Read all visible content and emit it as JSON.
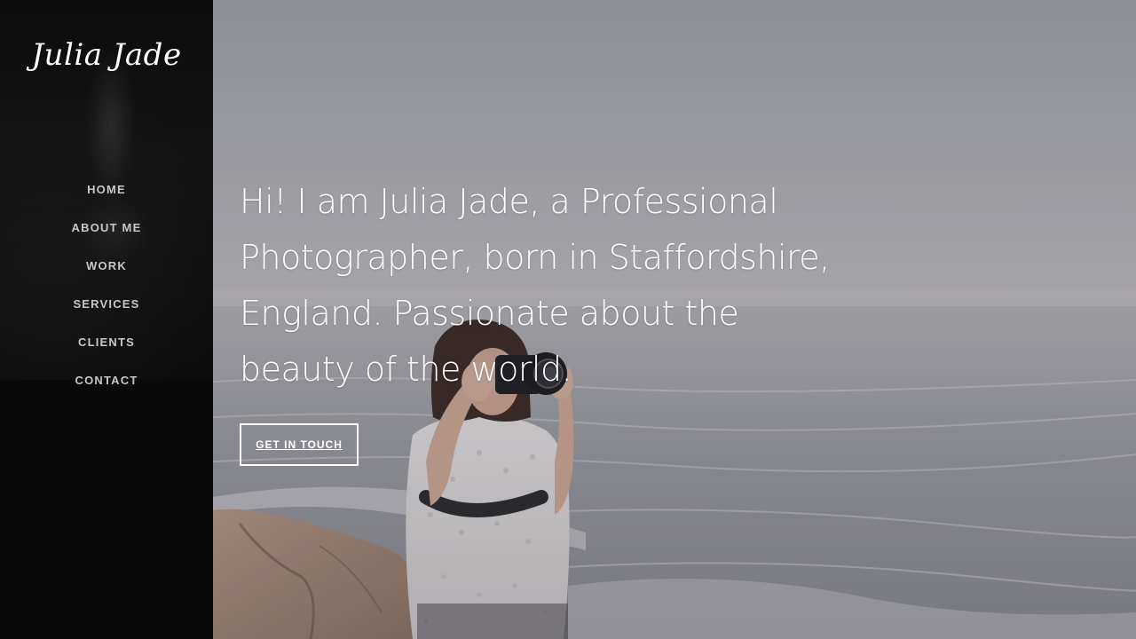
{
  "site": {
    "logo_text": "Julia Jade"
  },
  "nav": {
    "items": [
      {
        "label": "HOME"
      },
      {
        "label": "ABOUT ME"
      },
      {
        "label": "WORK"
      },
      {
        "label": "SERVICES"
      },
      {
        "label": "CLIENTS"
      },
      {
        "label": "CONTACT"
      }
    ]
  },
  "hero": {
    "headline": "Hi! I am Julia Jade, a Professional Photographer, born in Staffordshire, England. Passionate about the beauty of the world.",
    "cta_label": "GET IN TOUCH",
    "image_subject": "photographer-on-beach"
  },
  "colors": {
    "sidebar_bg": "#0a0a0a",
    "nav_text": "#c8c8c8",
    "hero_text": "#ffffff",
    "cta_border": "#ffffff"
  }
}
